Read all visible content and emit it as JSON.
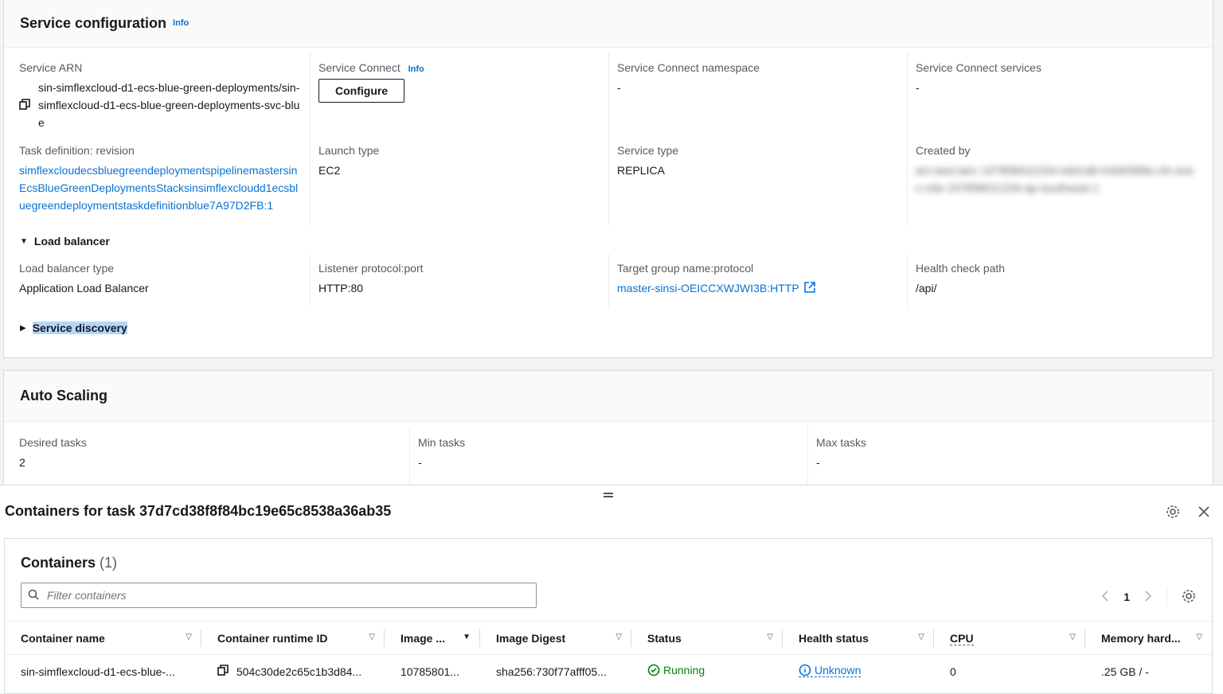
{
  "service_config": {
    "title": "Service configuration",
    "info": "Info",
    "service_arn_label": "Service ARN",
    "service_arn_value": "sin-simflexcloud-d1-ecs-blue-green-deployments/sin-simflexcloud-d1-ecs-blue-green-deployments-svc-blue",
    "service_connect_label": "Service Connect",
    "service_connect_info": "Info",
    "configure_button": "Configure",
    "sc_namespace_label": "Service Connect namespace",
    "sc_namespace_value": "-",
    "sc_services_label": "Service Connect services",
    "sc_services_value": "-",
    "task_def_label": "Task definition: revision",
    "task_def_value": "simflexcloudecsbluegreendeploymentspipelinemastersinEcsBlueGreenDeploymentsStacksinsimflexcloudd1ecsbluegreendeploymentstaskdefinitionblue7A97D2FB:1",
    "launch_type_label": "Launch type",
    "launch_type_value": "EC2",
    "service_type_label": "Service type",
    "service_type_value": "REPLICA",
    "created_by_label": "Created by",
    "created_by_value": "arn:aws:iam::107858011234:role/cdk-hnb659fds-cfn-exec-role-107858011234-ap-southeast-1",
    "load_balancer_expander": "Load balancer",
    "lb_type_label": "Load balancer type",
    "lb_type_value": "Application Load Balancer",
    "listener_label": "Listener protocol:port",
    "listener_value": "HTTP:80",
    "target_group_label": "Target group name:protocol",
    "target_group_value": "master-sinsi-OEICCXWJWI3B:HTTP",
    "health_check_label": "Health check path",
    "health_check_value": "/api/",
    "service_discovery_expander": "Service discovery"
  },
  "auto_scaling": {
    "title": "Auto Scaling",
    "desired_label": "Desired tasks",
    "desired_value": "2",
    "min_label": "Min tasks",
    "min_value": "-",
    "max_label": "Max tasks",
    "max_value": "-"
  },
  "drawer": {
    "title": "Containers for task 37d7cd38f8f84bc19e65c8538a36ab35",
    "containers_title": "Containers",
    "containers_count": "(1)",
    "search_placeholder": "Filter containers",
    "page_number": "1",
    "columns": [
      "Container name",
      "Container runtime ID",
      "Image ...",
      "Image Digest",
      "Status",
      "Health status",
      "CPU",
      "Memory hard..."
    ],
    "rows": [
      {
        "name": "sin-simflexcloud-d1-ecs-blue-...",
        "runtime_id": "504c30de2c65c1b3d84...",
        "image": "10785801...",
        "digest": "sha256:730f77afff05...",
        "status": "Running",
        "health": "Unknown",
        "cpu": "0",
        "memory": ".25 GB / -"
      }
    ]
  },
  "colors": {
    "link": "#0972d3",
    "success": "#037f0c",
    "highlight": "#b5d6fb"
  }
}
